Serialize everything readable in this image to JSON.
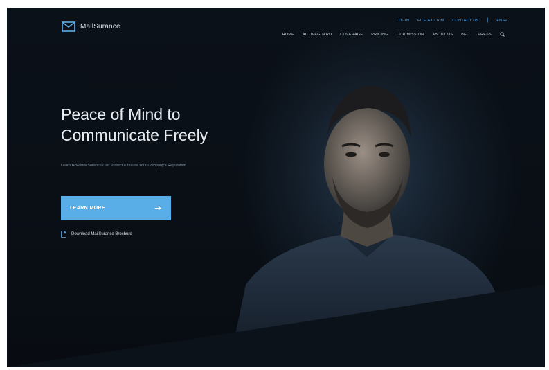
{
  "brand": {
    "name": "MailSurance",
    "accent_color": "#5aaee8",
    "link_color": "#4aa3e6",
    "background_color": "#0b1118"
  },
  "header": {
    "top_links": [
      {
        "label": "LOGIN"
      },
      {
        "label": "FILE A CLAIM"
      },
      {
        "label": "CONTACT US"
      }
    ],
    "language": "EN",
    "nav": [
      {
        "label": "HOME"
      },
      {
        "label": "ACTIVEGUARD"
      },
      {
        "label": "COVERAGE"
      },
      {
        "label": "PRICING"
      },
      {
        "label": "OUR MISSION"
      },
      {
        "label": "ABOUT US"
      },
      {
        "label": "BEC"
      },
      {
        "label": "PRESS"
      }
    ],
    "search_icon": "search-icon"
  },
  "hero": {
    "title_line1": "Peace of Mind to",
    "title_line2": "Communicate Freely",
    "subtitle": "Learn How MailSurance Can Protect & Insure Your Company's Reputation",
    "cta_label": "LEARN MORE",
    "cta_icon": "arrow-right-icon",
    "download_label": "Download MailSurance Brochure",
    "download_icon": "pdf-file-icon"
  }
}
